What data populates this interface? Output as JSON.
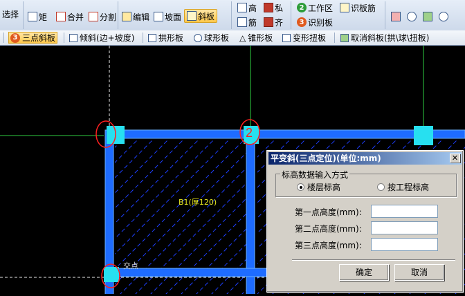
{
  "ribbon": {
    "select_label": "选择",
    "group1": [
      {
        "id": "rect",
        "label": "矩",
        "icon": "rectangle-icon"
      },
      {
        "id": "merge",
        "label": "合并",
        "icon": "merge-icon"
      },
      {
        "id": "split",
        "label": "分割",
        "icon": "split-icon"
      }
    ],
    "group2": [
      {
        "id": "edit",
        "label": "编辑",
        "icon": "edit-icon"
      },
      {
        "id": "slope_top",
        "label": "坡面",
        "icon": "slope-face-icon"
      },
      {
        "id": "slab",
        "label": "斜板",
        "icon": "sloped-slab-icon"
      }
    ],
    "group3": [
      {
        "id": "high",
        "label": "高",
        "icon": "height-icon"
      },
      {
        "id": "private",
        "label": "私",
        "icon": "private-icon"
      },
      {
        "id": "rebar",
        "label": "筋",
        "icon": "rebar-icon"
      },
      {
        "id": "align",
        "label": "齐",
        "icon": "align-icon"
      }
    ],
    "group4": [
      {
        "num": "2",
        "label": "工作区",
        "color": "#2e9d3a"
      },
      {
        "num": "3",
        "label": "识别板",
        "color": "#e05a1e"
      }
    ],
    "identify_rebar": "识板筋"
  },
  "toolbar2": [
    {
      "label": "三点斜板",
      "icon": "three-point-icon",
      "num": "3",
      "active": true
    },
    {
      "label": "倾斜(边+坡度)",
      "icon": "tilt-icon"
    },
    {
      "label": "拱形板",
      "icon": "arch-slab-icon"
    },
    {
      "label": "球形板",
      "icon": "sphere-slab-icon"
    },
    {
      "label": "锥形板",
      "icon": "cone-slab-icon"
    },
    {
      "label": "变形扭板",
      "icon": "twist-slab-icon"
    },
    {
      "label": "取消斜板(拱\\球\\扭板)",
      "icon": "cancel-slope-icon"
    }
  ],
  "canvas": {
    "slab_label": "B1(厚120)",
    "intersection_label": "交点",
    "point2_label": "2",
    "colors": {
      "beam": "#1e6cff",
      "beam_edge": "#6ab0ff",
      "column": "#27e0f0",
      "marker": "#ff2020",
      "axis": "#2ecc40",
      "axis_white": "#e8e8e8",
      "hatch": "#1e3fff",
      "label": "#e8e820"
    }
  },
  "dialog": {
    "title": "平变斜(三点定位)(单位:mm)",
    "group_title": "标高数据输入方式",
    "radio1": "楼层标高",
    "radio2": "按工程标高",
    "radio_selected": "楼层标高",
    "field1_label": "第一点高度(mm):",
    "field2_label": "第二点高度(mm):",
    "field3_label": "第三点高度(mm):",
    "field1_value": "",
    "field2_value": "",
    "field3_value": "",
    "ok": "确定",
    "cancel": "取消",
    "close": "✕"
  }
}
